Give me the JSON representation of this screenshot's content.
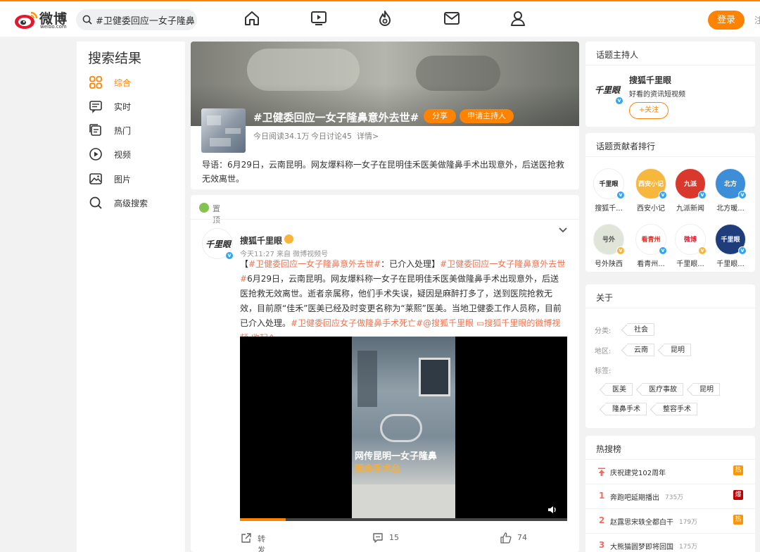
{
  "header": {
    "logo_text": "微博",
    "logo_sub": "weibo.com",
    "search_value": "#卫健委回应一女子隆鼻",
    "login_label": "登录",
    "cut_text": "注"
  },
  "sidebar": {
    "title": "搜索结果",
    "items": [
      {
        "label": "综合",
        "icon": "grid-icon"
      },
      {
        "label": "实时",
        "icon": "realtime-icon"
      },
      {
        "label": "热门",
        "icon": "hot-icon"
      },
      {
        "label": "视频",
        "icon": "video-icon"
      },
      {
        "label": "图片",
        "icon": "picture-icon"
      },
      {
        "label": "高级搜索",
        "icon": "search-icon"
      }
    ]
  },
  "topic": {
    "title": "#卫健委回应一女子隆鼻意外去世#",
    "share_label": "分享",
    "host_label": "申请主持人",
    "reads": "今日阅读34.1万",
    "discussions": "今日讨论45",
    "details": "详情>",
    "lead": "导语：6月29日，云南昆明。网友爆料称一女子在昆明佳禾医美做隆鼻手术出现意外，后送医抢救无效离世。"
  },
  "post": {
    "pin_label": "置顶",
    "author": "搜狐千里眼",
    "avatar_text": "千里眼",
    "meta": "今天11:27  来自 微博视频号",
    "body": [
      {
        "t": "【",
        "l": false
      },
      {
        "t": "#卫健委回应一女子隆鼻意外去世#",
        "l": true
      },
      {
        "t": "：已介入处理】",
        "l": false
      },
      {
        "t": "#卫健委回应一女子隆鼻意外去世#",
        "l": true
      },
      {
        "t": "6月29日，云南昆明。网友爆料称一女子在昆明佳禾医美做隆鼻手术出现意外，后送医抢救无效离世。逝者亲属称，他们手术失误，疑因是麻醉打多了，送到医院抢救无效，目前原“佳禾”医美已经及时变更名称为“莱熙”医美。当地卫健委工作人员称，目前已介入处理。",
        "l": false
      },
      {
        "t": "#卫健委回应女子做隆鼻手术死亡#",
        "l": true
      },
      {
        "t": "@搜狐千里眼",
        "l": true
      },
      {
        "t": " ",
        "l": false
      },
      {
        "t": "▭搜狐千里眼的微博视频",
        "l": true
      },
      {
        "t": " 收起⌃",
        "l": true
      }
    ],
    "video": {
      "caption_line1": "网传昆明一女子隆鼻",
      "caption_line2": "殒命手术台",
      "progress": 0.14
    },
    "actions": {
      "repost": "转发",
      "comments": "15",
      "likes": "74"
    }
  },
  "host_card": {
    "title": "话题主持人",
    "name": "搜狐千里眼",
    "desc": "好看的资讯短视频",
    "follow": "+关注",
    "avatar_text": "千里眼"
  },
  "contrib_card": {
    "title": "话题贡献者排行",
    "users": [
      {
        "name": "搜狐千...",
        "bg": "#ffffff",
        "fg": "#222222",
        "txt": "千里眼",
        "badge": "v"
      },
      {
        "name": "西安小记",
        "bg": "#f6b73c",
        "fg": "#ffffff",
        "txt": "西安小记",
        "badge": "v"
      },
      {
        "name": "九派新闻",
        "bg": "#d9382c",
        "fg": "#ffffff",
        "txt": "九派",
        "badge": "v"
      },
      {
        "name": "北方暖...",
        "bg": "#3d8ed8",
        "fg": "#ffffff",
        "txt": "北方",
        "badge": "v"
      },
      {
        "name": "号外陕西",
        "bg": "#dfe5d8",
        "fg": "#555555",
        "txt": "号外",
        "badge": "y"
      },
      {
        "name": "看青州...",
        "bg": "#ffffff",
        "fg": "#d8352a",
        "txt": "看青州",
        "badge": "v"
      },
      {
        "name": "千里眼...",
        "bg": "#ffffff",
        "fg": "#e6162d",
        "txt": "微博",
        "badge": "y"
      },
      {
        "name": "千里眼...",
        "bg": "#1f3d7a",
        "fg": "#ffffff",
        "txt": "千里眼",
        "badge": "v"
      }
    ]
  },
  "about_card": {
    "title": "关于",
    "category_label": "分类:",
    "category_tags": [
      "社会"
    ],
    "region_label": "地区:",
    "region_tags": [
      "云南",
      "昆明"
    ],
    "tags_label": "标签:",
    "tags_row1": [
      "医美",
      "医疗事故",
      "昆明"
    ],
    "tags_row2": [
      "隆鼻手术",
      "整容手术"
    ]
  },
  "hot_card": {
    "title": "热搜榜",
    "rows": [
      {
        "rank": "",
        "text": "庆祝建党102周年",
        "heat": "",
        "badge": "热",
        "badge_color": "#ff9406",
        "pinned": true
      },
      {
        "rank": "1",
        "text": "奔跑吧延期播出",
        "heat": "735万",
        "badge": "爆",
        "badge_color": "#bd0000",
        "pinned": false
      },
      {
        "rank": "2",
        "text": "赵露思宋轶全都白干",
        "heat": "179万",
        "badge": "热",
        "badge_color": "#ff9406",
        "pinned": false
      },
      {
        "rank": "3",
        "text": "大熊猫圆梦即将回国",
        "heat": "175万",
        "badge": "",
        "badge_color": "",
        "pinned": false
      }
    ]
  },
  "colors": {
    "accent": "#ff8200",
    "link": "#eb7350",
    "verified": "#2fa5f5"
  }
}
